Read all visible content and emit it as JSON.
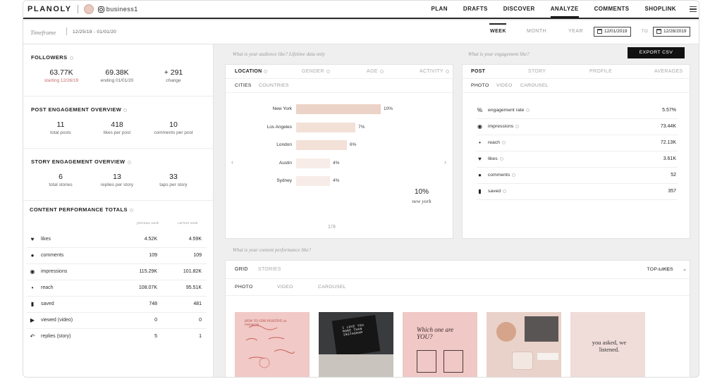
{
  "nav": {
    "logo": "PLANOLY",
    "account": "business1",
    "links": [
      "PLAN",
      "DRAFTS",
      "DISCOVER",
      "ANALYZE",
      "COMMENTS",
      "SHOPLINK"
    ]
  },
  "timeframe": {
    "label": "Timeframe",
    "range": "12/25/19 - 01/01/20",
    "periods": [
      "WEEK",
      "MONTH",
      "YEAR"
    ],
    "active_period": "WEEK",
    "start_date": "12/01/2019",
    "to_label": "TO",
    "end_date": "12/28/2019"
  },
  "followers": {
    "title": "FOLLOWERS",
    "stats": [
      {
        "value": "63.77K",
        "label": "starting 12/26/19"
      },
      {
        "value": "69.38K",
        "label": "ending 01/01/20"
      },
      {
        "value": "+ 291",
        "label": "change"
      }
    ]
  },
  "post_engagement": {
    "title": "POST ENGAGEMENT OVERVIEW",
    "stats": [
      {
        "value": "11",
        "label": "total posts"
      },
      {
        "value": "418",
        "label": "likes per post"
      },
      {
        "value": "10",
        "label": "comments per post"
      }
    ]
  },
  "story_engagement": {
    "title": "STORY ENGAGEMENT OVERVIEW",
    "stats": [
      {
        "value": "6",
        "label": "total stories"
      },
      {
        "value": "13",
        "label": "replies per story"
      },
      {
        "value": "33",
        "label": "taps per story"
      }
    ]
  },
  "content_performance": {
    "title": "CONTENT PERFORMANCE TOTALS",
    "col_previous": "previous week",
    "col_current": "current week",
    "rows": [
      {
        "icon": "heart-icon",
        "label": "likes",
        "previous": "4.52K",
        "current": "4.59K"
      },
      {
        "icon": "comment-icon",
        "label": "comments",
        "previous": "109",
        "current": "109"
      },
      {
        "icon": "eye-icon",
        "label": "impressions",
        "previous": "115.29K",
        "current": "101.82K"
      },
      {
        "icon": "reach-icon",
        "label": "reach",
        "previous": "108.07K",
        "current": "95.51K"
      },
      {
        "icon": "bookmark-icon",
        "label": "saved",
        "previous": "748",
        "current": "481"
      },
      {
        "icon": "play-icon",
        "label": "viewed (video)",
        "previous": "0",
        "current": "0"
      },
      {
        "icon": "reply-icon",
        "label": "replies (story)",
        "previous": "5",
        "current": "1"
      }
    ]
  },
  "audience": {
    "question": "What is your audience like?  Lifetime data only",
    "tabs": [
      "LOCATION",
      "GENDER",
      "AGE",
      "ACTIVITY"
    ],
    "active_tab": "LOCATION",
    "subtabs": [
      "CITIES",
      "COUNTRIES"
    ],
    "active_subtab": "CITIES",
    "cities": [
      {
        "name": "New York",
        "pct": 10,
        "label": "10%"
      },
      {
        "name": "Los Angeles",
        "pct": 7,
        "label": "7%"
      },
      {
        "name": "London",
        "pct": 6,
        "label": "6%"
      },
      {
        "name": "Austin",
        "pct": 4,
        "label": "4%"
      },
      {
        "name": "Sydney",
        "pct": 4,
        "label": "4%"
      }
    ],
    "highlight_value": "10%",
    "highlight_city": "new york",
    "pager": "1/9",
    "colors": {
      "top": "#ecd3c7",
      "mid": "#f3e1d8",
      "low": "#f7ece7"
    }
  },
  "engagement": {
    "question": "What is your engagement like?",
    "export_label": "EXPORT CSV",
    "tabs": [
      "POST",
      "STORY",
      "PROFILE",
      "AVERAGES"
    ],
    "active_tab": "POST",
    "subtabs": [
      "PHOTO",
      "VIDEO",
      "CAROUSEL"
    ],
    "active_subtab": "PHOTO",
    "rows": [
      {
        "icon": "percent-icon",
        "label": "engagement rate",
        "value": "5.57%"
      },
      {
        "icon": "eye-icon",
        "label": "impressions",
        "value": "73.44K"
      },
      {
        "icon": "reach-icon",
        "label": "reach",
        "value": "72.13K"
      },
      {
        "icon": "heart-icon",
        "label": "likes",
        "value": "3.61K"
      },
      {
        "icon": "comment-icon",
        "label": "comments",
        "value": "52"
      },
      {
        "icon": "bookmark-icon",
        "label": "saved",
        "value": "357"
      }
    ]
  },
  "content": {
    "question": "What is your content performance like?",
    "tabs": [
      "GRID",
      "STORIES"
    ],
    "active_tab": "GRID",
    "subtabs": [
      "PHOTO",
      "VIDEO",
      "CAROUSEL"
    ],
    "active_subtab": "PHOTO",
    "sort_label": "sort by:",
    "sort_value": "TOP LIKES",
    "thumbs": [
      {
        "name": "thumb-pink-lettering",
        "text": "HOW TO STAY POSITIVE on instagram",
        "bg": "#f1c9c6"
      },
      {
        "name": "thumb-letterboard",
        "text": "I LOVE YOU MORE THAN INSTAGRAM",
        "bg": "#2c2c2c"
      },
      {
        "name": "thumb-which-one",
        "text": "Which one are YOU?",
        "bg": "#f0c8c5"
      },
      {
        "name": "thumb-desk-photo",
        "text": "",
        "bg": "#e9d2c9"
      },
      {
        "name": "thumb-you-asked",
        "text": "you asked, we listened.",
        "bg": "#f0dcd9"
      }
    ]
  }
}
